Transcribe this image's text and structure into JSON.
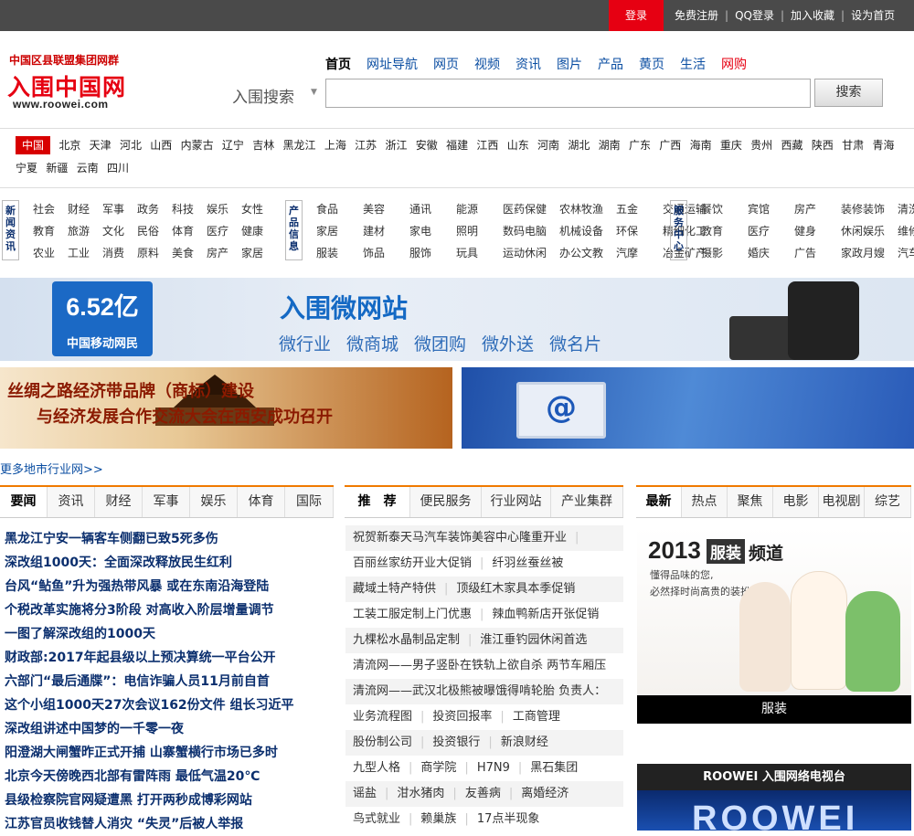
{
  "topbar": {
    "login": "登录",
    "links": [
      "免费注册",
      "QQ登录",
      "加入收藏",
      "设为首页"
    ],
    "separator": "|"
  },
  "logo": {
    "slogan": "中国区县联盟集团网群",
    "name": "入围中国网",
    "url": "www.roowei.com"
  },
  "search": {
    "tabs": [
      "首页",
      "网址导航",
      "网页",
      "视频",
      "资讯",
      "图片",
      "产品",
      "黄页",
      "生活",
      "网购"
    ],
    "active_tab": "首页",
    "label": "入围搜索",
    "arrow": "▼",
    "placeholder": "",
    "button": "搜索"
  },
  "provinces": [
    "中国",
    "北京",
    "天津",
    "河北",
    "山西",
    "内蒙古",
    "辽宁",
    "吉林",
    "黑龙江",
    "上海",
    "江苏",
    "浙江",
    "安徽",
    "福建",
    "江西",
    "山东",
    "河南",
    "湖北",
    "湖南",
    "广东",
    "广西",
    "海南",
    "重庆",
    "贵州",
    "西藏",
    "陕西",
    "甘肃",
    "青海",
    "宁夏",
    "新疆",
    "云南",
    "四川"
  ],
  "categories": [
    {
      "label": "新闻资讯",
      "rows": [
        [
          "社会",
          "财经",
          "军事",
          "政务",
          "科技",
          "娱乐",
          "女性"
        ],
        [
          "教育",
          "旅游",
          "文化",
          "民俗",
          "体育",
          "医疗",
          "健康"
        ],
        [
          "农业",
          "工业",
          "消费",
          "原料",
          "美食",
          "房产",
          "家居"
        ]
      ]
    },
    {
      "label": "产品信息",
      "rows": [
        [
          "食品",
          "美容",
          "通讯",
          "能源",
          "医药保健",
          "农林牧渔",
          "五金",
          "交通运输"
        ],
        [
          "家居",
          "建材",
          "家电",
          "照明",
          "数码电脑",
          "机械设备",
          "环保",
          "精细化工"
        ],
        [
          "服装",
          "饰品",
          "服饰",
          "玩具",
          "运动休闲",
          "办公文教",
          "汽摩",
          "冶金矿产"
        ]
      ]
    },
    {
      "label": "服务中心",
      "rows": [
        [
          "餐饮",
          "宾馆",
          "房产",
          "装修装饰",
          "清洗保洁"
        ],
        [
          "教育",
          "医疗",
          "健身",
          "休闲娱乐",
          "维修安装"
        ],
        [
          "摄影",
          "婚庆",
          "广告",
          "家政月嫂",
          "汽车保养"
        ]
      ]
    }
  ],
  "banner1": {
    "number": "6.52亿",
    "number_caption": "中国移动网民",
    "title": "入围微网站",
    "subtitles": [
      "微行业",
      "微商城",
      "微团购",
      "微外送",
      "微名片"
    ]
  },
  "banner2": {
    "line1": "丝绸之路经济带品牌（商标）建设",
    "line2": "与经济发展合作交流大会在西安成功召开"
  },
  "banner3": {
    "symbol": "@"
  },
  "more_cities": "更多地市行业网>>",
  "news": {
    "tabs": [
      "要闻",
      "资讯",
      "财经",
      "军事",
      "娱乐",
      "体育",
      "国际"
    ],
    "items": [
      "黑龙江宁安一辆客车侧翻已致5死多伤",
      "深改组1000天：全面深改释放民生红利",
      "台风“鲇鱼”升为强热带风暴 或在东南沿海登陆",
      "个税改革实施将分3阶段 对高收入阶层增量调节",
      "一图了解深改组的1000天",
      "财政部:2017年起县级以上预决算统一平台公开",
      "六部门“最后通牒”：电信诈骗人员11月前自首",
      "这个小组1000天27次会议162份文件 组长习近平",
      "深改组讲述中国梦的一千零一夜",
      "阳澄湖大闸蟹昨正式开捕 山寨蟹横行市场已多时",
      "北京今天傍晚西北部有雷阵雨 最低气温20℃",
      "县级检察院官网疑遭黑 打开两秒成博彩网站",
      "江苏官员收钱替人消灾 “失灵”后被人举报"
    ]
  },
  "recommend": {
    "tabs": [
      "推　荐",
      "便民服务",
      "行业网站",
      "产业集群"
    ],
    "rows": [
      [
        "祝贺新泰天马汽车装饰美容中心隆重开业"
      ],
      [
        "百丽丝家纺开业大促销",
        "纤羽丝蚕丝被"
      ],
      [
        "藏域土特产特供",
        "顶级红木家具本季促销"
      ],
      [
        "工装工服定制上门优惠",
        "辣血鸭新店开张促销"
      ],
      [
        "九棵松水晶制品定制",
        "淮江垂钓园休闲首选"
      ],
      [
        "清流网——男子竖卧在铁轨上欲自杀 两节车厢压"
      ],
      [
        "清流网——武汉北极熊被曝饿得啃轮胎 负责人："
      ],
      [
        "业务流程图",
        "投资回报率",
        "工商管理"
      ],
      [
        "股份制公司",
        "投资银行",
        "新浪财经"
      ],
      [
        "九型人格",
        "商学院",
        "H7N9",
        "黑石集团"
      ],
      [
        "谣盐",
        "泔水猪肉",
        "友善病",
        "离婚经济"
      ],
      [
        "鸟式就业",
        "赖巢族",
        "17点半现象"
      ]
    ]
  },
  "right": {
    "tabs": [
      "最新",
      "热点",
      "聚焦",
      "电影",
      "电视剧",
      "综艺"
    ],
    "promo": {
      "year": "2013",
      "box": "服装",
      "channel": "频道",
      "line1": "懂得品味的您,",
      "line2": "必然择时尚高贵的装扮!",
      "caption": "服装"
    },
    "tv_title": "ROOWEI 入围网络电视台",
    "tv_logo": "ROOWEI"
  },
  "colors": {
    "accent": "#e60012",
    "tab_border": "#f07a00",
    "link": "#0b4ea2",
    "topbar": "#4a4a4a"
  }
}
